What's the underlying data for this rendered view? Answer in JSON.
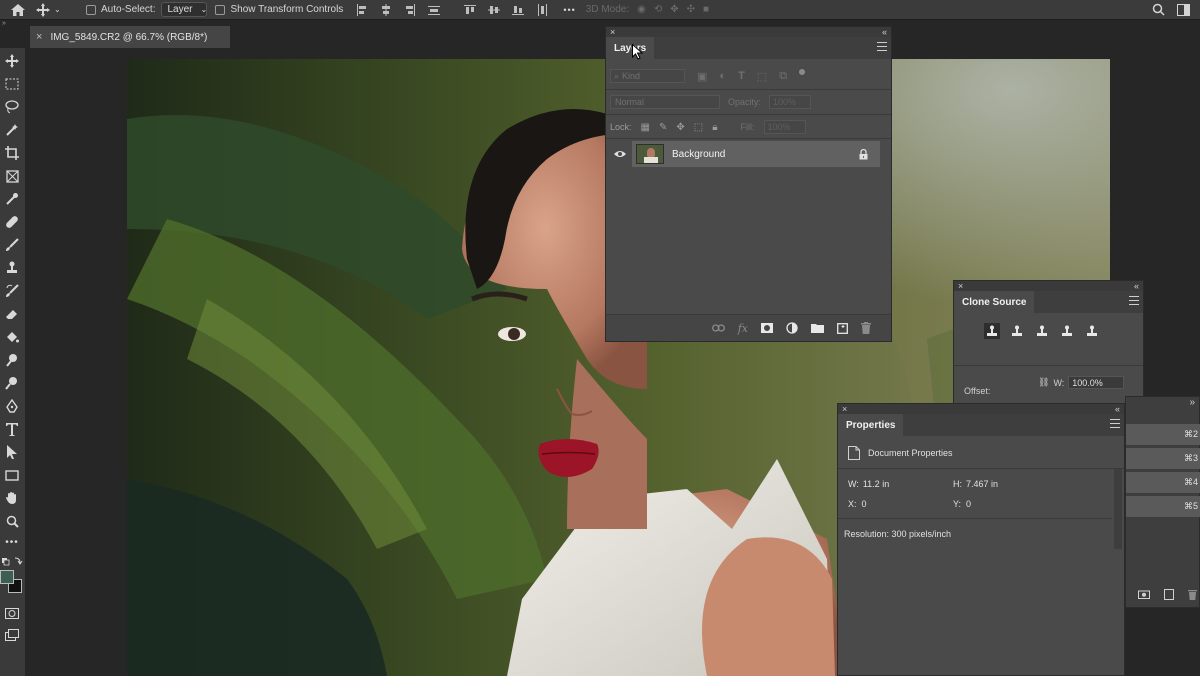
{
  "options_bar": {
    "auto_select_label": "Auto-Select:",
    "auto_select_value": "Layer",
    "show_transform_label": "Show Transform Controls",
    "mode_3d_label": "3D Mode:",
    "more_label": "•••"
  },
  "document": {
    "tab_title": "IMG_5849.CR2 @ 66.7% (RGB/8*)",
    "close_symbol": "×"
  },
  "layers_panel": {
    "tab_label": "Layers",
    "filter_kind": "Kind",
    "blend_mode": "Normal",
    "opacity_label": "Opacity:",
    "opacity_value": "100%",
    "lock_label": "Lock:",
    "fill_label": "Fill:",
    "fill_value": "100%",
    "layers": [
      {
        "name": "Background",
        "visible": true,
        "locked": true
      }
    ],
    "footer_icons": [
      "link-icon",
      "fx-icon",
      "mask-icon",
      "adjustment-icon",
      "folder-icon",
      "new-layer-icon",
      "trash-icon"
    ],
    "fx_label": "fx"
  },
  "clone_source_panel": {
    "tab_label": "Clone Source",
    "offset_label": "Offset:",
    "w_label": "W:",
    "w_value": "100.0%"
  },
  "properties_panel": {
    "tab_label": "Properties",
    "doc_props_label": "Document Properties",
    "w_label": "W:",
    "w_value": "11.2 in",
    "h_label": "H:",
    "h_value": "7.467 in",
    "x_label": "X:",
    "x_value": "0",
    "y_label": "Y:",
    "y_value": "0",
    "resolution": "Resolution: 300 pixels/inch"
  },
  "right_shortcuts": [
    "⌘2",
    "⌘3",
    "⌘4",
    "⌘5"
  ],
  "colors": {
    "foreground": "#3f5e52",
    "background": "#111111",
    "panel": "#4a4a4a",
    "ui_dark": "#262626"
  }
}
